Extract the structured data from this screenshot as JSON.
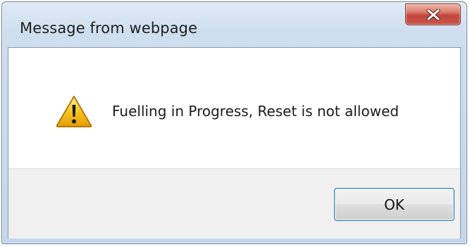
{
  "dialog": {
    "title": "Message from webpage",
    "close_icon": "close-icon",
    "message_icon": "warning-icon",
    "message": "Fuelling in Progress, Reset is not allowed",
    "ok_label": "OK"
  },
  "colors": {
    "frame": "#c3d5ea",
    "close_button": "#c9564a",
    "warning_yellow": "#f6c51c",
    "footer": "#f0f0f0",
    "ok_border": "#3c7fb1"
  }
}
